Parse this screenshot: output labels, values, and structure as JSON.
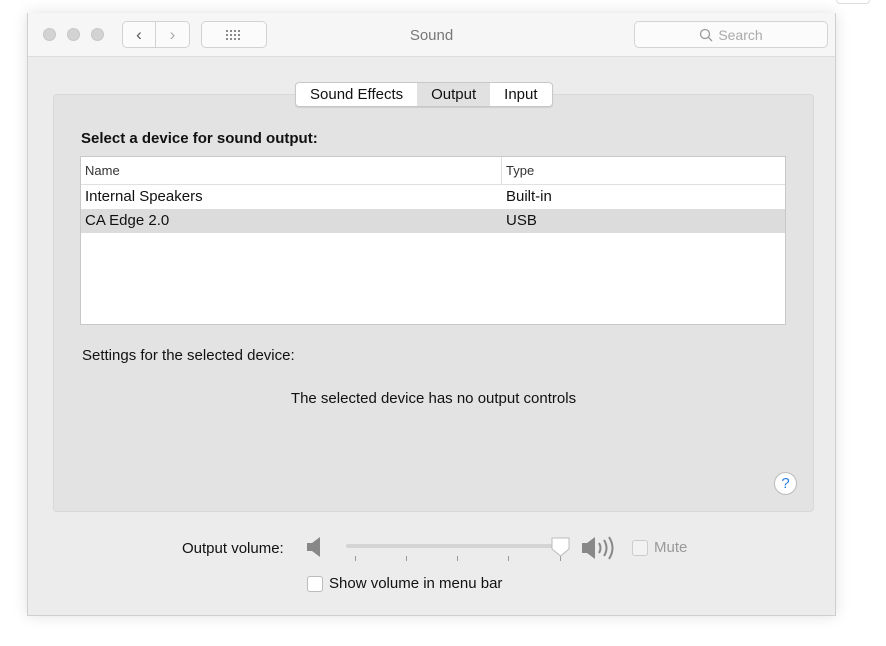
{
  "window": {
    "title": "Sound",
    "search_placeholder": "Search"
  },
  "tabs": [
    {
      "label": "Sound Effects",
      "selected": false
    },
    {
      "label": "Output",
      "selected": true
    },
    {
      "label": "Input",
      "selected": false
    }
  ],
  "output": {
    "heading": "Select a device for sound output:",
    "columns": [
      "Name",
      "Type"
    ],
    "devices": [
      {
        "name": "Internal Speakers",
        "type": "Built-in",
        "selected": false
      },
      {
        "name": "CA Edge 2.0",
        "type": "USB",
        "selected": true
      }
    ],
    "settings_label": "Settings for the selected device:",
    "no_controls_message": "The selected device has no output controls",
    "help_label": "?"
  },
  "volume": {
    "label": "Output volume:",
    "level_percent": 100,
    "mute_label": "Mute",
    "mute_checked": false,
    "mute_enabled": false,
    "show_in_menu_bar_label": "Show volume in menu bar",
    "show_in_menu_bar_checked": false
  }
}
